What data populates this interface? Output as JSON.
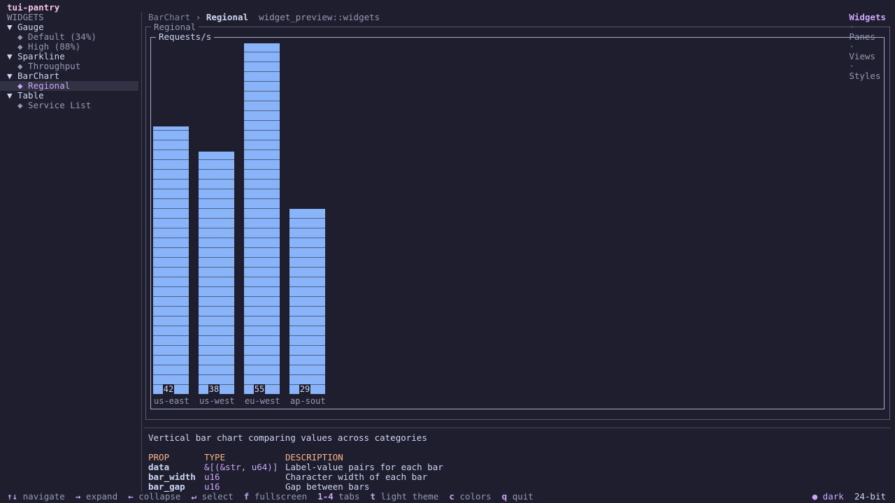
{
  "app": {
    "title": "tui-pantry"
  },
  "nav_tabs": [
    {
      "label": "Widgets",
      "active": true
    },
    {
      "label": "Panes",
      "active": false
    },
    {
      "label": "Views",
      "active": false
    },
    {
      "label": "Styles",
      "active": false
    }
  ],
  "nav_sep": "·",
  "sidebar": {
    "heading": "WIDGETS",
    "groups": [
      {
        "label": "Gauge",
        "expander": "▼",
        "items": [
          "◆ Default (34%)",
          "◆ High (88%)"
        ]
      },
      {
        "label": "Sparkline",
        "expander": "▼",
        "items": [
          "◆ Throughput"
        ]
      },
      {
        "label": "BarChart",
        "expander": "▼",
        "items": [
          "◆ Regional"
        ]
      },
      {
        "label": "Table",
        "expander": "▼",
        "items": [
          "◆ Service List"
        ]
      }
    ],
    "selected_item": "◆ Regional"
  },
  "breadcrumb": {
    "parent": "BarChart",
    "sep": "›",
    "current": "Regional",
    "module": "widget_preview::widgets"
  },
  "preview": {
    "outer_title": "Regional",
    "inner_title": "Requests/s"
  },
  "chart_data": {
    "type": "bar",
    "categories": [
      "us-east",
      "us-west",
      "eu-west",
      "ap-sout"
    ],
    "values": [
      42,
      38,
      55,
      29
    ],
    "value_labels": [
      "42",
      "38",
      "55",
      "29"
    ],
    "ylim": [
      0,
      55
    ],
    "title": "Requests/s",
    "bar_color": "#89b4fa",
    "bar_style": "segmented"
  },
  "description": "Vertical bar chart comparing values across categories",
  "props": {
    "headers": [
      "PROP",
      "TYPE",
      "DESCRIPTION"
    ],
    "rows": [
      {
        "prop": "data",
        "type": "&[(&str, u64)]",
        "desc": "Label-value pairs for each bar"
      },
      {
        "prop": "bar_width",
        "type": "u16",
        "desc": "Character width of each bar"
      },
      {
        "prop": "bar_gap",
        "type": "u16",
        "desc": "Gap between bars"
      }
    ]
  },
  "footer": {
    "hints": [
      {
        "key": "↑↓",
        "label": "navigate"
      },
      {
        "key": "→",
        "label": "expand"
      },
      {
        "key": "←",
        "label": "collapse"
      },
      {
        "key": "↵",
        "label": "select"
      },
      {
        "key": "f",
        "label": "fullscreen"
      },
      {
        "key": "1-4",
        "label": "tabs"
      },
      {
        "key": "t",
        "label": "light theme"
      },
      {
        "key": "c",
        "label": "colors"
      },
      {
        "key": "q",
        "label": "quit"
      }
    ],
    "theme_indicator": "● dark",
    "color_mode": "24-bit"
  },
  "colors": {
    "background": "#1e1e2e",
    "selection": "#313244",
    "accent": "#cba6f7",
    "title": "#f5c2e7",
    "header": "#fab387"
  }
}
